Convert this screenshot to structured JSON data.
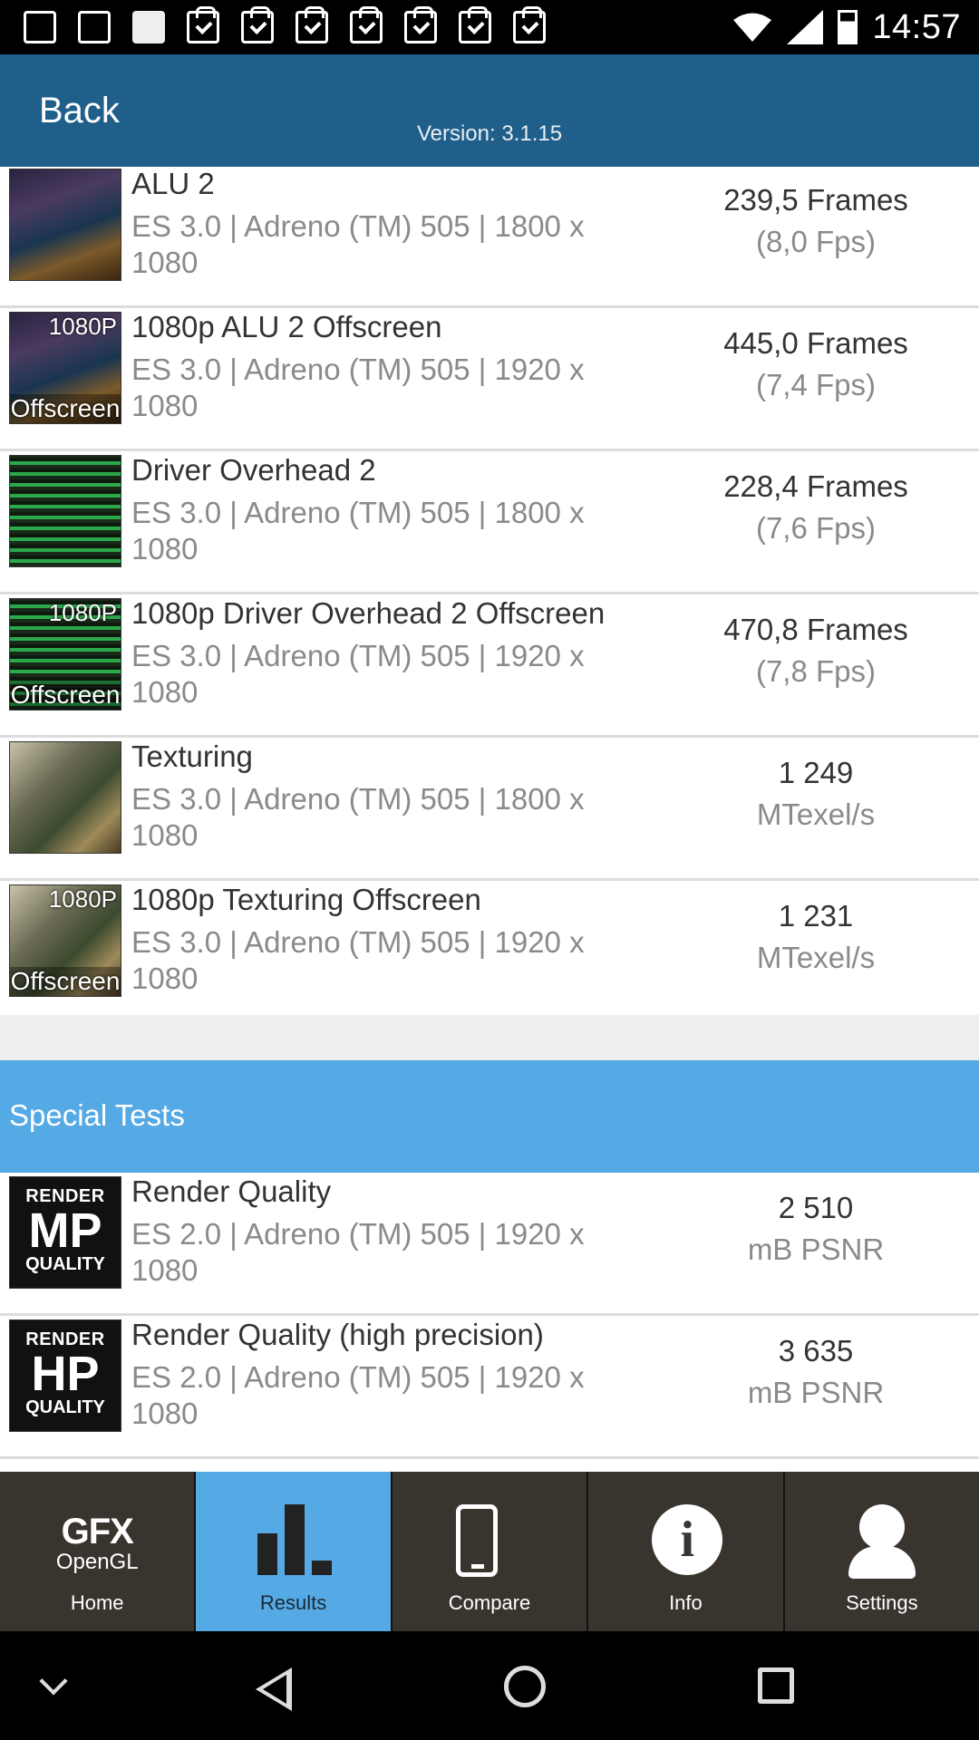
{
  "status_bar": {
    "time": "14:57",
    "notification_icons": [
      "photo-icon",
      "gmail-icon",
      "blank-app-icon",
      "shopping-bag-icon",
      "shopping-bag-icon",
      "shopping-bag-icon",
      "shopping-bag-icon",
      "shopping-bag-icon",
      "shopping-bag-icon",
      "shopping-bag-icon"
    ],
    "system_icons": [
      "wifi-icon",
      "signal-icon",
      "battery-icon"
    ]
  },
  "header": {
    "back_label": "Back",
    "version": "Version: 3.1.15",
    "color": "#1f5f8a"
  },
  "results": [
    {
      "name": "ALU 2",
      "details": "ES 3.0 | Adreno (TM) 505 | 1800 x 1080",
      "score": "239,5 Frames",
      "unit": "(8,0 Fps)",
      "thumb": "city"
    },
    {
      "name": "1080p ALU 2 Offscreen",
      "details": "ES 3.0 | Adreno (TM) 505 | 1920 x 1080",
      "score": "445,0 Frames",
      "unit": "(7,4 Fps)",
      "thumb": "city-offscreen",
      "badge_top": "1080P",
      "badge_bottom": "Offscreen"
    },
    {
      "name": "Driver Overhead 2",
      "details": "ES 3.0 | Adreno (TM) 505 | 1800 x 1080",
      "score": "228,4 Frames",
      "unit": "(7,6 Fps)",
      "thumb": "overhead"
    },
    {
      "name": "1080p Driver Overhead 2 Offscreen",
      "details": "ES 3.0 | Adreno (TM) 505 | 1920 x 1080",
      "score": "470,8 Frames",
      "unit": "(7,8 Fps)",
      "thumb": "overhead-offscreen",
      "badge_top": "1080P",
      "badge_bottom": "Offscreen"
    },
    {
      "name": "Texturing",
      "details": "ES 3.0 | Adreno (TM) 505 | 1800 x 1080",
      "score": "1 249",
      "unit": "MTexel/s",
      "thumb": "dino"
    },
    {
      "name": "1080p Texturing Offscreen",
      "details": "ES 3.0 | Adreno (TM) 505 | 1920 x 1080",
      "score": "1 231",
      "unit": "MTexel/s",
      "thumb": "dino-offscreen",
      "badge_top": "1080P",
      "badge_bottom": "Offscreen"
    }
  ],
  "special_section": {
    "title": "Special Tests",
    "color": "#55a9e4"
  },
  "special_results": [
    {
      "name": "Render Quality",
      "details": "ES 2.0 | Adreno (TM) 505 | 1920 x 1080",
      "score": "2 510",
      "unit": "mB PSNR",
      "badge_top": "RENDER",
      "badge_mid": "MP",
      "badge_bottom": "QUALITY"
    },
    {
      "name": "Render Quality (high precision)",
      "details": "ES 2.0 | Adreno (TM) 505 | 1920 x 1080",
      "score": "3 635",
      "unit": "mB PSNR",
      "badge_top": "RENDER",
      "badge_mid": "HP",
      "badge_bottom": "QUALITY"
    }
  ],
  "bottom_nav": {
    "home": {
      "label": "Home",
      "logo_top": "GFX",
      "logo_bottom": "OpenGL"
    },
    "results": {
      "label": "Results",
      "active": true
    },
    "compare": {
      "label": "Compare"
    },
    "info": {
      "label": "Info",
      "glyph": "i"
    },
    "settings": {
      "label": "Settings"
    }
  },
  "system_nav": [
    "chevron-down-icon",
    "back-triangle-icon",
    "home-circle-icon",
    "recents-square-icon"
  ]
}
